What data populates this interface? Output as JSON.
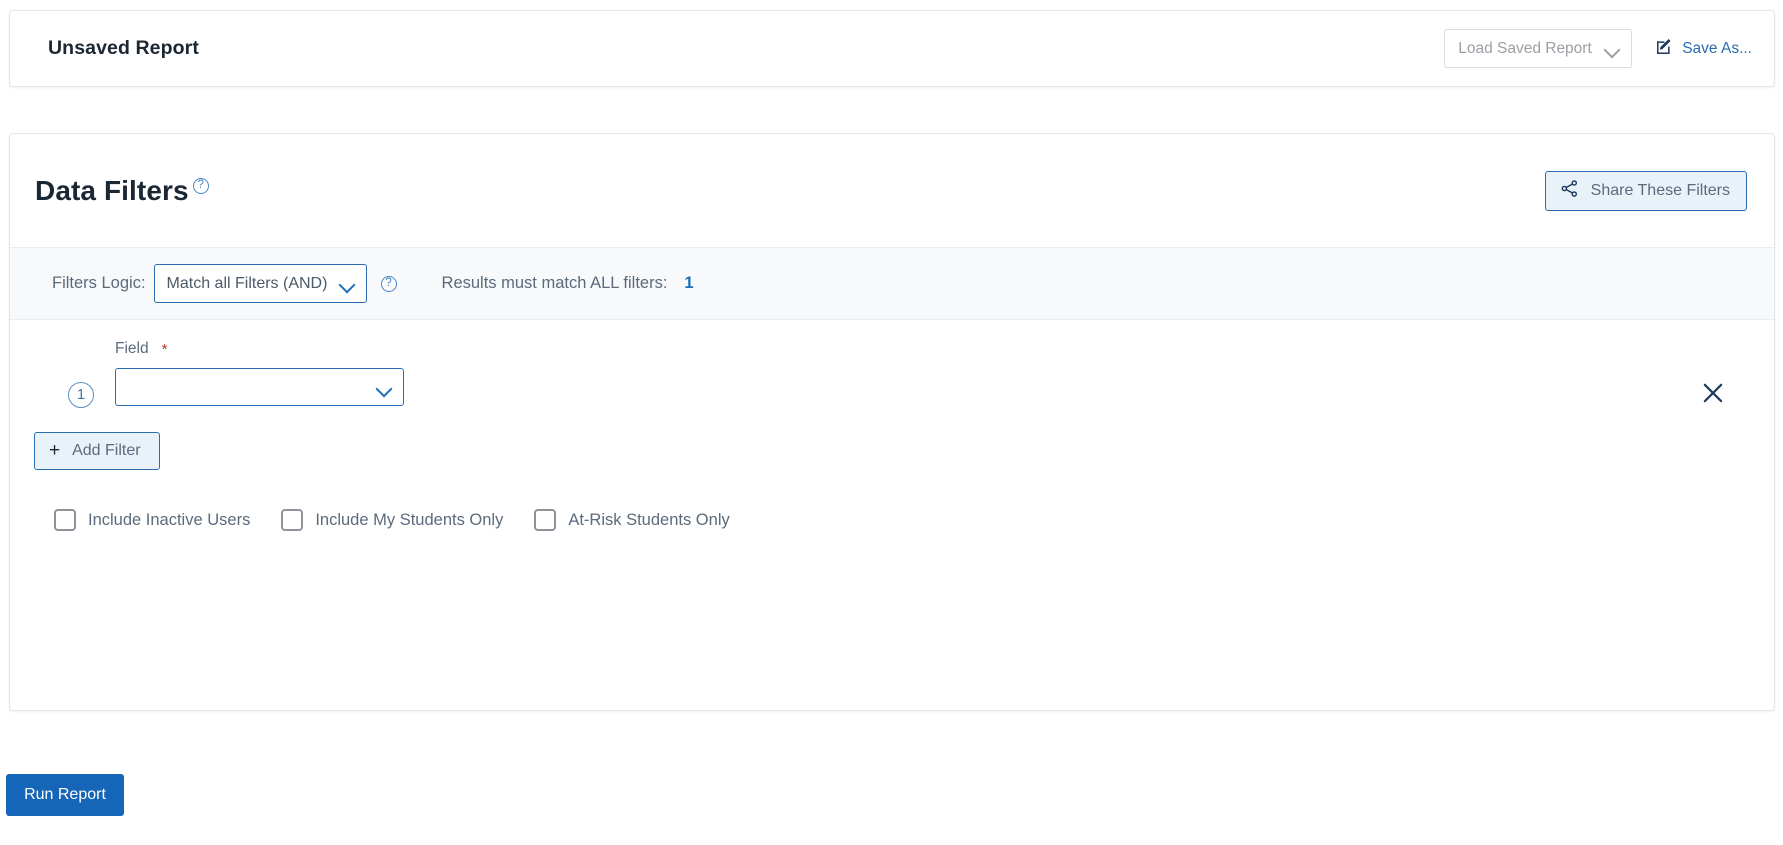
{
  "header": {
    "report_title": "Unsaved Report",
    "load_saved_report_placeholder": "Load Saved Report",
    "save_as_label": "Save As...",
    "save_as_icon": "edit-pencil-square-icon",
    "load_chevron_icon": "chevron-down-icon"
  },
  "filters": {
    "title": "Data Filters",
    "title_help_icon": "question-mark-circle-icon",
    "title_help_glyph": "?",
    "share_button_label": "Share These Filters",
    "share_icon": "share-nodes-icon",
    "logic": {
      "label": "Filters Logic:",
      "selected_option": "Match all Filters (AND)",
      "options": [
        "Match all Filters (AND)"
      ],
      "help_icon": "question-mark-circle-icon",
      "help_glyph": "?",
      "chevron_icon": "chevron-down-icon",
      "result_text": "Results must match ALL filters:",
      "result_count": "1"
    },
    "rows": [
      {
        "index": "1",
        "field_label": "Field",
        "required_marker": "*",
        "field_value": "",
        "field_chevron_icon": "chevron-down-icon",
        "remove_icon": "close-x-icon"
      }
    ],
    "add_filter_label": "Add Filter",
    "add_filter_plus": "+",
    "checkboxes": [
      {
        "label": "Include Inactive Users",
        "checked": false
      },
      {
        "label": "Include My Students Only",
        "checked": false
      },
      {
        "label": "At-Risk Students Only",
        "checked": false
      }
    ]
  },
  "footer": {
    "run_report_label": "Run Report"
  },
  "colors": {
    "accent_blue": "#1565b8",
    "link_blue": "#2b6cb0",
    "soft_blue_bg": "#e9f1f9",
    "text_gray": "#5b6b7c",
    "required_red": "#c0392b",
    "strip_bg": "#f8f9fa"
  }
}
